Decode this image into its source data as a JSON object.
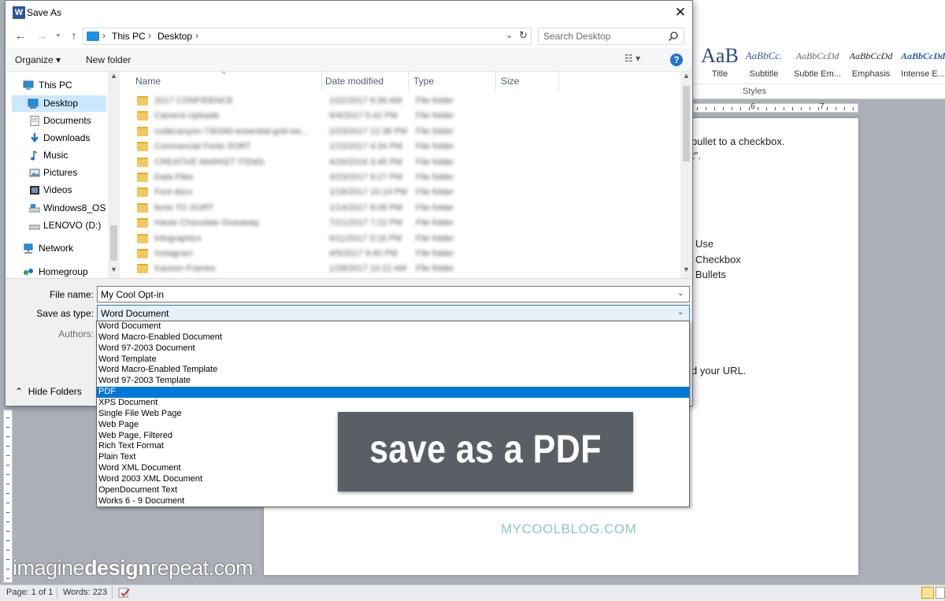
{
  "window_title": "Save As",
  "close_glyph": "✕",
  "nav": {
    "back_glyph": "←",
    "forward_glyph": "→",
    "recent_glyph": "⌄",
    "up_glyph": "↑",
    "breadcrumb": [
      "This PC",
      "Desktop"
    ],
    "chevron": "›",
    "search_placeholder": "Search Desktop"
  },
  "toolbar": {
    "organize_label": "Organize ▾",
    "new_folder_label": "New folder",
    "view_label": "☷ ▾",
    "help_label": "?"
  },
  "sidebar": {
    "items": [
      {
        "label": "This PC",
        "icon": "computer-icon"
      },
      {
        "label": "Desktop",
        "icon": "desktop-icon",
        "selected": true
      },
      {
        "label": "Documents",
        "icon": "documents-icon"
      },
      {
        "label": "Downloads",
        "icon": "downloads-icon"
      },
      {
        "label": "Music",
        "icon": "music-icon"
      },
      {
        "label": "Pictures",
        "icon": "pictures-icon"
      },
      {
        "label": "Videos",
        "icon": "videos-icon"
      },
      {
        "label": "Windows8_OS (C",
        "icon": "drive-icon"
      },
      {
        "label": "LENOVO (D:)",
        "icon": "drive-icon"
      },
      {
        "label": "Network",
        "icon": "network-icon"
      },
      {
        "label": "Homegroup",
        "icon": "homegroup-icon"
      }
    ]
  },
  "file_list": {
    "columns": [
      "Name",
      "Date modified",
      "Type",
      "Size"
    ],
    "rows": [
      {
        "name": "2017 CONFIDENCE",
        "date": "10/2/2017 8:36 AM",
        "type": "File folder"
      },
      {
        "name": "Camera Uploads",
        "date": "9/4/2017 5:42 PM",
        "type": "File folder"
      },
      {
        "name": "codecanyon-730340-essential-grid-wo...",
        "date": "2/23/2017 12:36 PM",
        "type": "File folder"
      },
      {
        "name": "Commercial Fonts SORT",
        "date": "1/15/2017 4:34 PM",
        "type": "File folder"
      },
      {
        "name": "CREATIVE MARKET ITEMS",
        "date": "4/26/2016 3:45 PM",
        "type": "File folder"
      },
      {
        "name": "Data Files",
        "date": "3/23/2017 9:27 PM",
        "type": "File folder"
      },
      {
        "name": "Font docs",
        "date": "1/18/2017 10:19 PM",
        "type": "File folder"
      },
      {
        "name": "fonts TO SORT",
        "date": "1/14/2017 8:08 PM",
        "type": "File folder"
      },
      {
        "name": "Haute Chocolate Giveaway",
        "date": "7/21/2017 7:22 PM",
        "type": "File folder"
      },
      {
        "name": "Infographics",
        "date": "6/11/2017 3:18 PM",
        "type": "File folder"
      },
      {
        "name": "Instagram",
        "date": "4/5/2017 9:40 PM",
        "type": "File folder"
      },
      {
        "name": "Kavoon Frames",
        "date": "1/28/2017 10:22 AM",
        "type": "File folder"
      }
    ]
  },
  "form": {
    "file_name_label": "File name:",
    "file_name_value": "My Cool Opt-in",
    "save_type_label": "Save as type:",
    "save_type_value": "Word Document",
    "authors_label": "Authors:",
    "hide_folders_label": "Hide Folders",
    "dropdown_glyph": "⌄"
  },
  "save_type_options": [
    "Word Document",
    "Word Macro-Enabled Document",
    "Word 97-2003 Document",
    "Word Template",
    "Word Macro-Enabled Template",
    "Word 97-2003 Template",
    "PDF",
    "XPS Document",
    "Single File Web Page",
    "Web Page",
    "Web Page, Filtered",
    "Rich Text Format",
    "Plain Text",
    "Word XML Document",
    "Word 2003 XML Document",
    "OpenDocument Text",
    "Works 6 - 9 Document"
  ],
  "selected_save_type": "PDF",
  "word": {
    "styles": [
      {
        "sample": "AaB",
        "name": "Title"
      },
      {
        "sample": "AaBbCc.",
        "name": "Subtitle"
      },
      {
        "sample": "AaBbCcDd",
        "name": "Subtle Em..."
      },
      {
        "sample": "AaBbCcDd",
        "name": "Emphasis"
      },
      {
        "sample": "AaBbCcDd",
        "name": "Intense E..."
      }
    ],
    "styles_group_label": "Styles",
    "ruler_marks": [
      "6",
      "7"
    ],
    "doc_lines": [
      "bullet to a checkbox.",
      "t\".",
      "Use",
      "Checkbox",
      "Bullets",
      "d your URL."
    ],
    "status_page": "Page: 1 of 1",
    "status_words": "Words: 223",
    "blog_watermark": "MYCOOLBLOG.COM"
  },
  "site_watermark": {
    "part1": "imagine",
    "part2": "design",
    "part3": "repeat",
    "part4": ".com"
  },
  "caption": "save as a PDF",
  "colors": {
    "selection_blue": "#0078d7",
    "nav_selected": "#cce8ff",
    "caption_bg": "#5a5f66",
    "word_blue": "#2b579a"
  }
}
